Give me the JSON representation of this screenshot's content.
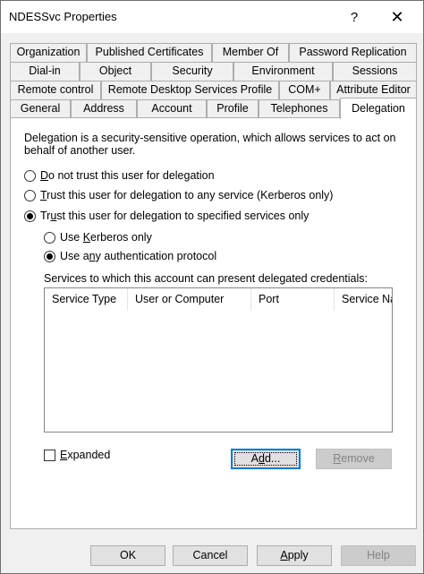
{
  "window": {
    "title": "NDESSvc Properties",
    "help_glyph": "?",
    "close_glyph": "✕"
  },
  "tabs": {
    "row1": [
      "Organization",
      "Published Certificates",
      "Member Of",
      "Password Replication"
    ],
    "row2": [
      "Dial-in",
      "Object",
      "Security",
      "Environment",
      "Sessions"
    ],
    "row3": [
      "Remote control",
      "Remote Desktop Services Profile",
      "COM+",
      "Attribute Editor"
    ],
    "row4": [
      "General",
      "Address",
      "Account",
      "Profile",
      "Telephones",
      "Delegation"
    ],
    "active": "Delegation"
  },
  "delegation": {
    "description": "Delegation is a security-sensitive operation, which allows services to act on behalf of another user.",
    "options": [
      {
        "accel": "D",
        "rest": "o not trust this user for delegation",
        "checked": false
      },
      {
        "accel": "T",
        "rest": "rust this user for delegation to any service (Kerberos only)",
        "checked": false
      },
      {
        "accel": "",
        "pre": "Tr",
        "accel2": "u",
        "rest": "st this user for delegation to specified services only",
        "checked": true
      }
    ],
    "sub_options": [
      {
        "pre": "Use ",
        "accel": "K",
        "rest": "erberos only",
        "checked": false
      },
      {
        "pre": "Use a",
        "accel": "n",
        "rest": "y authentication protocol",
        "checked": true
      }
    ],
    "services_label": "Services to which this account can present delegated credentials:",
    "columns": [
      "Service Type",
      "User or Computer",
      "Port",
      "Service Na"
    ],
    "expanded": {
      "accel": "E",
      "rest": "xpanded",
      "checked": false
    },
    "add_button": {
      "pre": "A",
      "accel": "d",
      "rest": "d..."
    },
    "remove_button": {
      "accel": "R",
      "rest": "emove"
    }
  },
  "footer": {
    "ok": "OK",
    "cancel": "Cancel",
    "apply_accel": "A",
    "apply_rest": "pply",
    "help": "Help"
  }
}
